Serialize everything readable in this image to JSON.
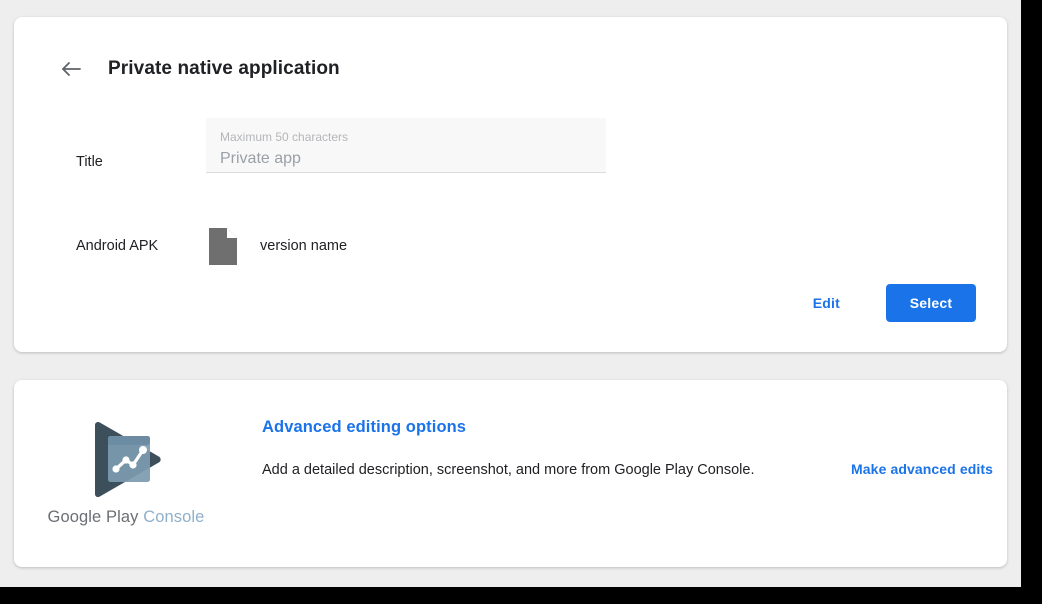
{
  "header": {
    "back_icon": "arrow-left-icon",
    "title": "Private native application"
  },
  "form": {
    "title_row": {
      "label": "Title",
      "hint": "Maximum 50 characters",
      "value": "Private app"
    },
    "apk_row": {
      "label": "Android APK",
      "file_icon": "file-document-icon",
      "version": "version name"
    },
    "actions": {
      "edit_label": "Edit",
      "select_label": "Select"
    }
  },
  "promo": {
    "logo": {
      "icon": "google-play-console-logo",
      "word_google": "Google",
      "word_play": "Play",
      "word_console": "Console"
    },
    "heading": "Advanced editing options",
    "description": "Add a detailed description, screenshot, and more from Google Play Console.",
    "link_label": "Make advanced edits"
  },
  "colors": {
    "accent_blue": "#1a73e8",
    "page_background": "#eeeeee",
    "card_background": "#ffffff",
    "text_primary": "#202124",
    "text_muted": "#9aa0a6",
    "field_background": "#f8f8f8",
    "logo_dark": "#3e4f5c",
    "logo_light": "#7c9bb0"
  }
}
